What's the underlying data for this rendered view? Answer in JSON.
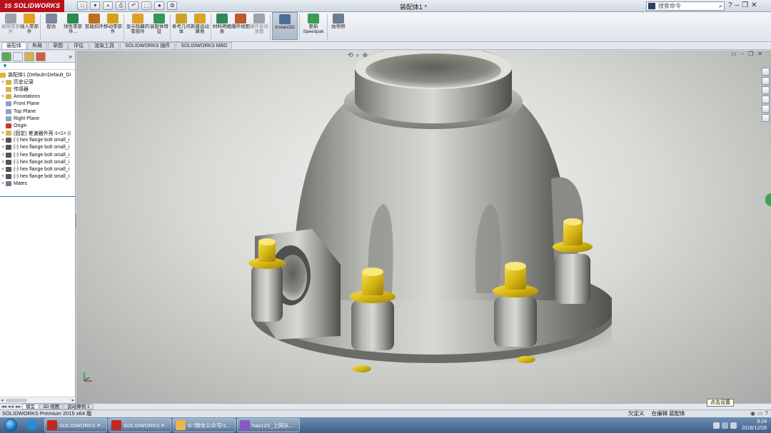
{
  "app": {
    "brand": "SOLIDWORKS",
    "brand_prefix": "3S",
    "document_title": "装配体1 *"
  },
  "search": {
    "placeholder": "搜索命令"
  },
  "ribbon": {
    "buttons": [
      {
        "label": "编辑零部件",
        "color": "#9aa3ad",
        "dim": true
      },
      {
        "label": "插入零部件",
        "color": "#e2a21b"
      },
      {
        "label": "配合",
        "color": "#7a8898"
      },
      {
        "label": "线性零部件...",
        "color": "#2d8a4a"
      },
      {
        "label": "智能扣件",
        "color": "#c46a1c"
      },
      {
        "label": "移动零部件",
        "color": "#d4a017"
      },
      {
        "label": "显示隐藏的零部件",
        "color": "#e0a020"
      },
      {
        "label": "装配体特征",
        "color": "#2f9a51"
      },
      {
        "label": "参考几何体",
        "color": "#c9a32a"
      },
      {
        "label": "新建运动算例",
        "color": "#d7a51f"
      },
      {
        "label": "材料明细表",
        "color": "#2e8b57"
      },
      {
        "label": "爆炸视图",
        "color": "#c05a2a"
      },
      {
        "label": "爆炸直线草图",
        "color": "#9aa3ad",
        "dim": true
      },
      {
        "label": "Instant3D",
        "color": "#4a6f9a"
      },
      {
        "label": "更新Speedpak",
        "color": "#3f9b4f"
      },
      {
        "label": "拍快照",
        "color": "#6c7c8f"
      }
    ]
  },
  "command_tabs": [
    "装配体",
    "布局",
    "草图",
    "评估",
    "渲染工具",
    "SOLIDWORKS 插件",
    "SOLIDWORKS MBD"
  ],
  "feature_tree": {
    "root": "装配体1  (Default<Default_Di",
    "nodes": [
      {
        "label": "历史记录",
        "level": 1,
        "expand": "+",
        "color": "#d8b14a"
      },
      {
        "label": "传感器",
        "level": 1,
        "expand": "",
        "color": "#d8b14a"
      },
      {
        "label": "Annotations",
        "level": 1,
        "expand": "+",
        "color": "#d8b14a"
      },
      {
        "label": "Front Plane",
        "level": 1,
        "expand": "",
        "color": "#8aa4c8"
      },
      {
        "label": "Top Plane",
        "level": 1,
        "expand": "",
        "color": "#8aa4c8"
      },
      {
        "label": "Right Plane",
        "level": 1,
        "expand": "",
        "color": "#8aa4c8"
      },
      {
        "label": "Origin",
        "level": 1,
        "expand": "",
        "color": "#c0392b"
      },
      {
        "label": "(固定) 差速器外壳-1<1> (I",
        "level": 1,
        "expand": "+",
        "color": "#e2b23a"
      },
      {
        "label": "(-) hex flange bolt small_i",
        "level": 1,
        "expand": "+",
        "color": "#555"
      },
      {
        "label": "(-) hex flange bolt small_i",
        "level": 1,
        "expand": "+",
        "color": "#555"
      },
      {
        "label": "(-) hex flange bolt small_i",
        "level": 1,
        "expand": "+",
        "color": "#555"
      },
      {
        "label": "(-) hex flange bolt small_i",
        "level": 1,
        "expand": "+",
        "color": "#555"
      },
      {
        "label": "(-) hex flange bolt small_i",
        "level": 1,
        "expand": "+",
        "color": "#555"
      },
      {
        "label": "(-) hex flange bolt small_i",
        "level": 1,
        "expand": "+",
        "color": "#555"
      },
      {
        "label": "Mates",
        "level": 1,
        "expand": "+",
        "color": "#6e7f94"
      }
    ]
  },
  "bottom_tabs": [
    "模型",
    "3D 视图",
    "运动算例 1"
  ],
  "tooltip": "点击设置",
  "status": {
    "left": "SOLIDWORKS Premium 2015 x64 版",
    "mid1": "欠定义",
    "mid2": "在编辑 装配体"
  },
  "taskbar": {
    "buttons": [
      {
        "label": "SOLIDWORKS P...",
        "color": "#c0281f"
      },
      {
        "label": "SOLIDWORKS P...",
        "color": "#c0281f"
      },
      {
        "label": "G:\\微信公众号\\1...",
        "color": "#e6b94a"
      },
      {
        "label": "hao123_上网从...",
        "color": "#8a55c8"
      }
    ],
    "time": "9:24",
    "date": "2018/12/28"
  }
}
